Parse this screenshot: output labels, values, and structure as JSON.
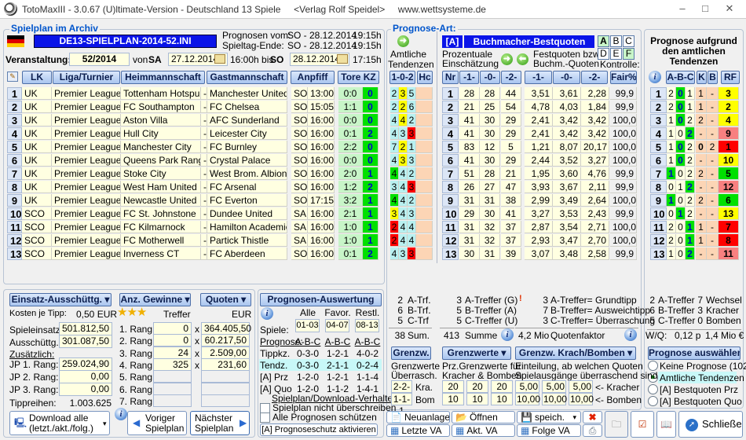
{
  "title": "TotoMaxIII - 3.0.67 (U)ltimate-Version - Deutschland 13 Spiele     <Verlag Rolf Speidel>     www.wettsysteme.de",
  "spielplan": {
    "group_title": "Spielplan im Archiv",
    "file": "DE13-SPIELPLAN-2014-52.INI",
    "prognosen_vom_label": "Prognosen vom:",
    "prognosen_vom": "SO - 28.12.2014",
    "prognosen_vom_time": "19:15h",
    "spieltag_ende_label": "Spieltag-Ende:",
    "spieltag_ende": "SO - 28.12.2014",
    "spieltag_ende_time": "19:15h",
    "veranstaltung_label": "Veranstaltung:",
    "veranstaltung": "52/2014",
    "von_label": "von",
    "von_day": "SA",
    "von_date": "27.12.2014",
    "von_time": "16:00h bis",
    "bis_day": "SO",
    "bis_date": "28.12.2014",
    "bis_time": "17:15h",
    "headers": {
      "lk": "LK",
      "liga": "Liga/Turnier",
      "heim": "Heimmannschaft",
      "gast": "Gastmannschaft",
      "anpfiff": "Anpfiff",
      "tore": "Tore KZ"
    },
    "rows": [
      [
        "1",
        "UK",
        "Premier League",
        "Tottenham Hotspur",
        "Manchester United",
        "SO",
        "13:00",
        "0:0",
        "0"
      ],
      [
        "2",
        "UK",
        "Premier League",
        "FC Southampton",
        "FC Chelsea",
        "SO",
        "15:05",
        "1:1",
        "0"
      ],
      [
        "3",
        "UK",
        "Premier League",
        "Aston Villa",
        "AFC Sunderland",
        "SO",
        "16:00",
        "0:0",
        "0"
      ],
      [
        "4",
        "UK",
        "Premier League",
        "Hull City",
        "Leicester City",
        "SO",
        "16:00",
        "0:1",
        "2"
      ],
      [
        "5",
        "UK",
        "Premier League",
        "Manchester City",
        "FC Burnley",
        "SO",
        "16:00",
        "2:2",
        "0"
      ],
      [
        "6",
        "UK",
        "Premier League",
        "Queens Park Rang...",
        "Crystal Palace",
        "SO",
        "16:00",
        "0:0",
        "0"
      ],
      [
        "7",
        "UK",
        "Premier League",
        "Stoke City",
        "West Brom. Albion",
        "SO",
        "16:00",
        "2:0",
        "1"
      ],
      [
        "8",
        "UK",
        "Premier League",
        "West Ham United",
        "FC Arsenal",
        "SO",
        "16:00",
        "1:2",
        "2"
      ],
      [
        "9",
        "UK",
        "Premier League",
        "Newcastle United",
        "FC Everton",
        "SO",
        "17:15",
        "3:2",
        "1"
      ],
      [
        "10",
        "SCO",
        "Premier League",
        "FC St. Johnstone",
        "Dundee United",
        "SA",
        "16:00",
        "2:1",
        "1"
      ],
      [
        "11",
        "SCO",
        "Premier League",
        "FC Kilmarnock",
        "Hamilton Academical",
        "SA",
        "16:00",
        "1:0",
        "1"
      ],
      [
        "12",
        "SCO",
        "Premier League",
        "FC Motherwell",
        "Partick Thistle",
        "SA",
        "16:00",
        "1:0",
        "1"
      ],
      [
        "13",
        "SCO",
        "Premier League",
        "Inverness CT",
        "FC Aberdeen",
        "SO",
        "16:00",
        "0:1",
        "2"
      ]
    ]
  },
  "prognose_art": {
    "group_title": "Prognose-Art:",
    "amtliche": "Amtliche",
    "tendenzen": "Tendenzen",
    "badge": "[A]",
    "banner": "Buchmacher-Bestquoten",
    "abc": [
      "A",
      "B",
      "C",
      "D",
      "E",
      "F"
    ],
    "abc_active": [
      "A",
      "F"
    ],
    "prz_1": "Prozentuale",
    "prz_2": "Einschätzung",
    "fq_1": "Festquoten bzw.",
    "fq_2": "Buchm.-Quoten",
    "kontrolle": "Kontrolle:",
    "headers": {
      "tend": "1-0-2",
      "hc": "Hc",
      "nr": "Nr",
      "p1": "-1-",
      "p0": "-0-",
      "p2": "-2-",
      "q1": "-1-",
      "q0": "-0-",
      "q2": "-2-",
      "fair": "Fair%"
    },
    "tend": [
      [
        "2",
        "3",
        "5",
        1,
        "y"
      ],
      [
        "2",
        "2",
        "6",
        1,
        "y"
      ],
      [
        "4",
        "4",
        "2",
        1,
        "y"
      ],
      [
        "4",
        "3",
        "3",
        2,
        "r"
      ],
      [
        "7",
        "2",
        "1",
        1,
        "y"
      ],
      [
        "4",
        "3",
        "3",
        1,
        "y"
      ],
      [
        "4",
        "4",
        "2",
        0,
        "g"
      ],
      [
        "3",
        "4",
        "3",
        2,
        "r"
      ],
      [
        "4",
        "4",
        "2",
        0,
        "g"
      ],
      [
        "3",
        "4",
        "3",
        0,
        "y"
      ],
      [
        "2",
        "4",
        "4",
        0,
        "r"
      ],
      [
        "2",
        "4",
        "4",
        0,
        "r"
      ],
      [
        "4",
        "3",
        "3",
        2,
        "r"
      ]
    ],
    "rows": [
      [
        "1",
        "28",
        "28",
        "44",
        "3,51",
        "3,61",
        "2,28",
        "99,9"
      ],
      [
        "2",
        "21",
        "25",
        "54",
        "4,78",
        "4,03",
        "1,84",
        "99,9"
      ],
      [
        "3",
        "41",
        "30",
        "29",
        "2,41",
        "3,42",
        "3,42",
        "100,0"
      ],
      [
        "4",
        "41",
        "30",
        "29",
        "2,41",
        "3,42",
        "3,42",
        "100,0"
      ],
      [
        "5",
        "83",
        "12",
        "5",
        "1,21",
        "8,07",
        "20,17",
        "100,0"
      ],
      [
        "6",
        "41",
        "30",
        "29",
        "2,44",
        "3,52",
        "3,27",
        "100,0"
      ],
      [
        "7",
        "51",
        "28",
        "21",
        "1,95",
        "3,60",
        "4,76",
        "99,9"
      ],
      [
        "8",
        "26",
        "27",
        "47",
        "3,93",
        "3,67",
        "2,11",
        "99,9"
      ],
      [
        "9",
        "31",
        "31",
        "38",
        "2,99",
        "3,49",
        "2,64",
        "100,0"
      ],
      [
        "10",
        "29",
        "30",
        "41",
        "3,27",
        "3,53",
        "2,43",
        "99,9"
      ],
      [
        "11",
        "31",
        "32",
        "37",
        "2,87",
        "3,54",
        "2,71",
        "100,0"
      ],
      [
        "12",
        "31",
        "32",
        "37",
        "2,93",
        "3,47",
        "2,70",
        "100,0"
      ],
      [
        "13",
        "30",
        "31",
        "39",
        "3,07",
        "3,48",
        "2,58",
        "99,9"
      ]
    ]
  },
  "right": {
    "title_1": "Prognose aufgrund",
    "title_2": "den amtlichen",
    "title_3": "Tendenzen",
    "headers": {
      "abc": "A-B-C",
      "k": "K",
      "b": "B",
      "rf": "RF"
    },
    "rows": [
      [
        "1",
        "2",
        "0",
        "1",
        1,
        "1",
        "-",
        "3",
        "y"
      ],
      [
        "2",
        "2",
        "0",
        "1",
        1,
        "1",
        "-",
        "2",
        "y"
      ],
      [
        "3",
        "1",
        "0",
        "2",
        1,
        "2",
        "-",
        "4",
        "y"
      ],
      [
        "4",
        "1",
        "0",
        "2",
        2,
        "-",
        "-",
        "9",
        "s"
      ],
      [
        "5",
        "1",
        "0",
        "2",
        1,
        "0",
        "2",
        "1",
        "r"
      ],
      [
        "6",
        "1",
        "0",
        "2",
        1,
        "-",
        "-",
        "10",
        "y"
      ],
      [
        "7",
        "1",
        "0",
        "2",
        0,
        "2",
        "-",
        "5",
        "g"
      ],
      [
        "8",
        "0",
        "1",
        "2",
        2,
        "-",
        "-",
        "12",
        "s"
      ],
      [
        "9",
        "1",
        "0",
        "2",
        0,
        "2",
        "-",
        "6",
        "g"
      ],
      [
        "10",
        "0",
        "1",
        "2",
        1,
        "-",
        "-",
        "13",
        "y"
      ],
      [
        "11",
        "2",
        "0",
        "1",
        2,
        "1",
        "-",
        "7",
        "r"
      ],
      [
        "12",
        "2",
        "0",
        "1",
        2,
        "1",
        "-",
        "8",
        "r"
      ],
      [
        "13",
        "1",
        "0",
        "2",
        2,
        "-",
        "-",
        "11",
        "s"
      ]
    ],
    "stats": [
      [
        "2",
        "A-Treffer",
        "7",
        "Wechsel"
      ],
      [
        "6",
        "B-Treffer",
        "3",
        "Kracher"
      ],
      [
        "5",
        "C-Treffer",
        "0",
        "Bomben"
      ]
    ],
    "wq_label": "W/Q:",
    "wq": "0,12 p",
    "wq_amount": "1,4 Mio €",
    "select_button": "Prognose auswählen",
    "radios": [
      {
        "label": "Keine Prognose (102)",
        "checked": false
      },
      {
        "label": "Amtliche Tendenzen",
        "checked": true
      },
      {
        "label": "[A] Bestquoten Prz",
        "checked": false
      },
      {
        "label": "[A] Bestquoten Quo",
        "checked": false
      }
    ]
  },
  "einsatz": {
    "dd1": "Einsatz-Ausschüttg.",
    "dd2": "Anz. Gewinne",
    "dd3": "Quoten",
    "kosten_label": "Kosten je Tipp:",
    "kosten": "0,50 EUR",
    "treffer": "Treffer",
    "eur": "EUR",
    "spieleinsatz_label": "Spieleinsatz:",
    "spieleinsatz": "501.812,50",
    "ausschuettg_label": "Ausschüttg.",
    "ausschuettg": "301.087,50",
    "zusaetzlich": "Zusätzlich:",
    "jp": [
      [
        "JP 1. Rang:",
        "259.024,90"
      ],
      [
        "JP 2. Rang:",
        "0,00"
      ],
      [
        "JP 3. Rang:",
        "0,00"
      ]
    ],
    "tippreihen_label": "Tippreihen:",
    "tippreihen": "1.003.625",
    "raenge": [
      [
        "1. Rang",
        "0",
        "364.405,50"
      ],
      [
        "2. Rang",
        "0",
        "60.217,50"
      ],
      [
        "3. Rang",
        "24",
        "2.509,00"
      ],
      [
        "4. Rang",
        "325",
        "231,60"
      ],
      [
        "5. Rang",
        "",
        ""
      ],
      [
        "6. Rang",
        "",
        ""
      ],
      [
        "7. Rang",
        "",
        ""
      ]
    ],
    "x": "x",
    "download_1": "Download alle",
    "download_2": "(letzt./akt./folg.)",
    "voriger_1": "Voriger",
    "voriger_2": "Spielplan",
    "naechster_1": "Nächster",
    "naechster_2": "Spielplan"
  },
  "auswertung": {
    "title": "Prognosen-Auswertung",
    "cols": [
      "Alle",
      "Favor.",
      "Restl."
    ],
    "spiele_label": "Spiele:",
    "spiele": [
      "01-03",
      "04-07",
      "08-13"
    ],
    "rows": [
      [
        "Prognose:",
        "A-B-C",
        "A-B-C",
        "A-B-C"
      ],
      [
        "Tippkz.",
        "0-3-0",
        "1-2-1",
        "4-0-2"
      ],
      [
        "Tendz.",
        "0-3-0",
        "2-1-1",
        "0-2-4"
      ],
      [
        "[A] Prz",
        "1-2-0",
        "1-2-1",
        "1-1-4"
      ],
      [
        "[A] Quo",
        "1-2-0",
        "1-1-2",
        "1-4-1"
      ]
    ],
    "verhalten": "Spielplan/Download-Verhalten",
    "chk1": "Spielplan nicht überschreiben",
    "chk2": "Alle Prognosen schützen",
    "schutz": "[A] Prognoseschutz aktivieren"
  },
  "stats": {
    "c1": [
      [
        "2",
        "A-Trf."
      ],
      [
        "6",
        "B-Trf."
      ],
      [
        "5",
        "C-Trf"
      ]
    ],
    "c1_sum": [
      "38",
      "Sum."
    ],
    "c2": [
      [
        "3",
        "A-Treffer (G)"
      ],
      [
        "5",
        "B-Treffer (A)"
      ],
      [
        "5",
        "C-Treffer (U)"
      ]
    ],
    "c2_sum": [
      "413",
      "Summe"
    ],
    "c3": [
      [
        "3",
        "A-Treffer= Grundtipp"
      ],
      [
        "7",
        "B-Treffer= Ausweichtipp"
      ],
      [
        "3",
        "C-Treffer= Überraschung"
      ]
    ],
    "c3_sum": [
      "4,2 Mio",
      "Quotenfaktor"
    ],
    "grenzw": "Grenzw.",
    "grenzw_t1": "Grenzwerte",
    "grenzw_t2": "Überrasch.",
    "kra_val": "2-2-2",
    "kra": "Kra.",
    "bom_val": "1-1-1",
    "bom": "Bom",
    "grenzwerte": "Grenzwerte",
    "gw_t1": "Prz.Grenzwerte für",
    "gw_t2": "Kracher & Bomben",
    "gw_k": [
      "20",
      "20",
      "20"
    ],
    "gw_b": [
      "10",
      "10",
      "10"
    ],
    "krach": "Grenzw. Krach/Bomben",
    "kb_t1": "Einteilung, ab welchen Quoten",
    "kb_t2": "Spielausgänge überraschend sind",
    "kb_k": [
      "5,00",
      "5,00",
      "5,00"
    ],
    "kb_b": [
      "10,00",
      "10,00",
      "10,00"
    ],
    "kracher_lbl": "<- Kracher",
    "bomben_lbl": "<- Bomben"
  },
  "toolbar": {
    "neuanlage": "Neuanlage",
    "oeffnen": "Öffnen",
    "speich": "speich.",
    "letzte": "Letzte VA",
    "akt": "Akt. VA",
    "folge": "Folge VA",
    "schliessen": "Schließen"
  },
  "colors": {
    "kz_green": "#00e000",
    "yellow": "#ffff00",
    "red": "#ff0000",
    "salmon": "#f88080",
    "banner": "#0a14e8"
  }
}
